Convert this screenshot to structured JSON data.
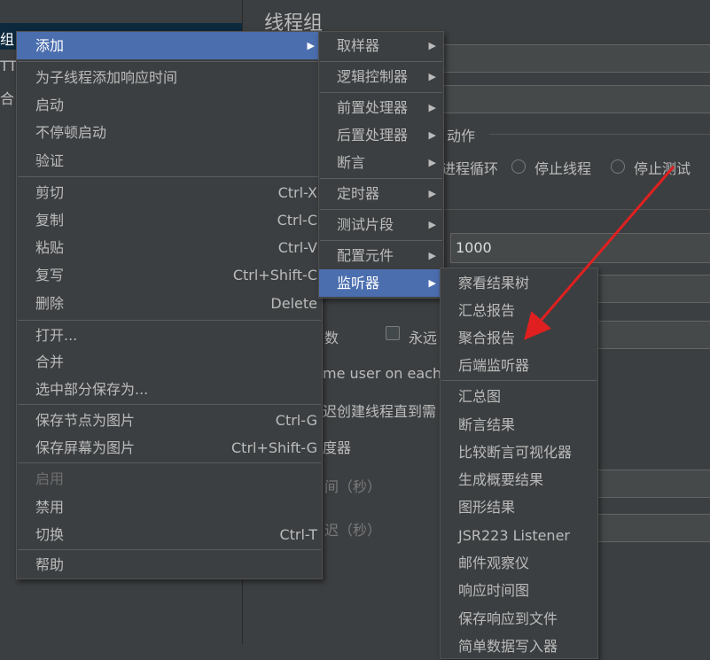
{
  "background": {
    "tree": {
      "item1": "组",
      "item2": "TTF",
      "item3": "合"
    },
    "panel": {
      "title": "线程组",
      "action_label": "动作",
      "radio_loop": "进程循环",
      "radio_stop_thread": "停止线程",
      "radio_stop_test": "停止测试",
      "loop_value": "1000",
      "loop_count_label": "数",
      "forever_label": "永远",
      "same_user_label": "me user on each",
      "delay_create_label": "迟创建线程直到需",
      "scheduler_label": "度器",
      "duration_label": "间（秒）",
      "startup_delay_label": "迟（秒）"
    }
  },
  "context_menu": {
    "items": [
      {
        "label": "添加",
        "shortcut": "",
        "submenu": true
      },
      {
        "label": "为子线程添加响应时间",
        "shortcut": ""
      },
      {
        "label": "启动",
        "shortcut": ""
      },
      {
        "label": "不停顿启动",
        "shortcut": ""
      },
      {
        "label": "验证",
        "shortcut": ""
      },
      {
        "label": "剪切",
        "shortcut": "Ctrl-X"
      },
      {
        "label": "复制",
        "shortcut": "Ctrl-C"
      },
      {
        "label": "粘贴",
        "shortcut": "Ctrl-V"
      },
      {
        "label": "复写",
        "shortcut": "Ctrl+Shift-C"
      },
      {
        "label": "删除",
        "shortcut": "Delete"
      },
      {
        "label": "打开...",
        "shortcut": ""
      },
      {
        "label": "合并",
        "shortcut": ""
      },
      {
        "label": "选中部分保存为...",
        "shortcut": ""
      },
      {
        "label": "保存节点为图片",
        "shortcut": "Ctrl-G"
      },
      {
        "label": "保存屏幕为图片",
        "shortcut": "Ctrl+Shift-G"
      },
      {
        "label": "启用",
        "shortcut": ""
      },
      {
        "label": "禁用",
        "shortcut": ""
      },
      {
        "label": "切换",
        "shortcut": "Ctrl-T"
      },
      {
        "label": "帮助",
        "shortcut": ""
      }
    ]
  },
  "add_submenu": {
    "items": [
      "取样器",
      "逻辑控制器",
      "前置处理器",
      "后置处理器",
      "断言",
      "定时器",
      "测试片段",
      "配置元件",
      "监听器"
    ]
  },
  "listener_submenu": {
    "items": [
      "察看结果树",
      "汇总报告",
      "聚合报告",
      "后端监听器",
      "汇总图",
      "断言结果",
      "比较断言可视化器",
      "生成概要结果",
      "图形结果",
      "JSR223 Listener",
      "邮件观察仪",
      "响应时间图",
      "保存响应到文件",
      "简单数据写入器"
    ]
  },
  "colors": {
    "menu_bg": "#3c3f41",
    "selection": "#4b6eaf",
    "annotation_arrow": "#e02020"
  },
  "icons": {
    "submenu_arrow": "▶"
  }
}
